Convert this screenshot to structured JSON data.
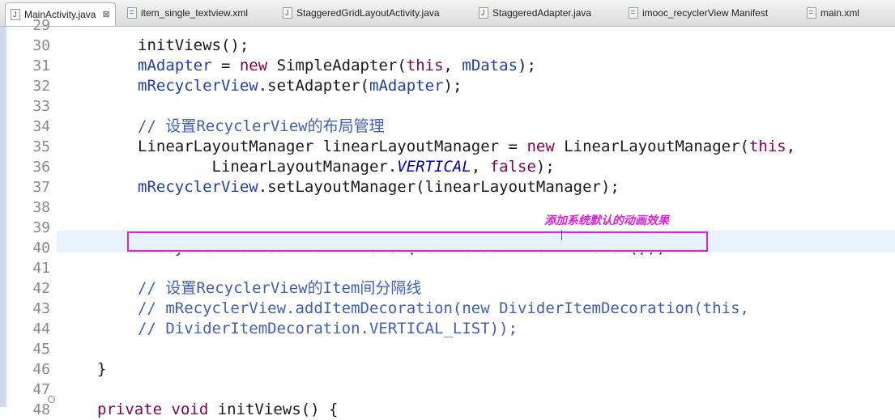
{
  "tabs": [
    {
      "label": "MainActivity.java",
      "icon": "java-file-icon",
      "active": true
    },
    {
      "label": "item_single_textview.xml",
      "icon": "xml-file-icon"
    },
    {
      "label": "StaggeredGridLayoutActivity.java",
      "icon": "java-file-icon"
    },
    {
      "label": "StaggeredAdapter.java",
      "icon": "java-file-icon"
    },
    {
      "label": "imooc_recyclerView Manifest",
      "icon": "xml-file-icon"
    },
    {
      "label": "main.xml",
      "icon": "xml-file-icon"
    }
  ],
  "close_glyph": "⊠",
  "annotation": "添加系统默认的动画效果",
  "lines": [
    {
      "n": "29",
      "tokens": []
    },
    {
      "n": "30",
      "tokens": [
        {
          "t": "initViews();",
          "c": "plain"
        }
      ]
    },
    {
      "n": "31",
      "tokens": [
        {
          "t": "mAdapter",
          "c": "field"
        },
        {
          "t": " = ",
          "c": "plain"
        },
        {
          "t": "new",
          "c": "kw"
        },
        {
          "t": " SimpleAdapter(",
          "c": "plain"
        },
        {
          "t": "this",
          "c": "kw"
        },
        {
          "t": ", ",
          "c": "plain"
        },
        {
          "t": "mDatas",
          "c": "field"
        },
        {
          "t": ");",
          "c": "plain"
        }
      ]
    },
    {
      "n": "32",
      "tokens": [
        {
          "t": "mRecyclerView",
          "c": "field"
        },
        {
          "t": ".setAdapter(",
          "c": "plain"
        },
        {
          "t": "mAdapter",
          "c": "field"
        },
        {
          "t": ");",
          "c": "plain"
        }
      ]
    },
    {
      "n": "33",
      "tokens": []
    },
    {
      "n": "34",
      "tokens": [
        {
          "t": "// 设置RecyclerView的布局管理",
          "c": "cmt"
        }
      ]
    },
    {
      "n": "35",
      "tokens": [
        {
          "t": "LinearLayoutManager linearLayoutManager = ",
          "c": "plain"
        },
        {
          "t": "new",
          "c": "kw"
        },
        {
          "t": " LinearLayoutManager(",
          "c": "plain"
        },
        {
          "t": "this",
          "c": "kw"
        },
        {
          "t": ",",
          "c": "plain"
        }
      ]
    },
    {
      "n": "36",
      "tokens": [
        {
          "t": "        LinearLayoutManager.",
          "c": "plain"
        },
        {
          "t": "VERTICAL",
          "c": "static"
        },
        {
          "t": ", ",
          "c": "plain"
        },
        {
          "t": "false",
          "c": "kw"
        },
        {
          "t": ");",
          "c": "plain"
        }
      ]
    },
    {
      "n": "37",
      "tokens": [
        {
          "t": "mRecyclerView",
          "c": "field"
        },
        {
          "t": ".setLayoutManager(linearLayoutManager);",
          "c": "plain"
        }
      ]
    },
    {
      "n": "38",
      "tokens": []
    },
    {
      "n": "39",
      "tokens": []
    },
    {
      "n": "40",
      "tokens": [
        {
          "t": "mRecyclerView",
          "c": "field"
        },
        {
          "t": ".setItemAnimator(",
          "c": "plain"
        },
        {
          "t": "new",
          "c": "kw"
        },
        {
          "t": " DefaultItemAnimator());",
          "c": "plain"
        }
      ]
    },
    {
      "n": "41",
      "tokens": []
    },
    {
      "n": "42",
      "tokens": [
        {
          "t": "// 设置RecyclerView的Item间分隔线",
          "c": "cmt"
        }
      ]
    },
    {
      "n": "43",
      "tokens": [
        {
          "t": "// mRecyclerView.addItemDecoration(new DividerItemDecoration(this,",
          "c": "cmt"
        }
      ]
    },
    {
      "n": "44",
      "tokens": [
        {
          "t": "// DividerItemDecoration.VERTICAL_LIST));",
          "c": "cmt"
        }
      ]
    },
    {
      "n": "45",
      "tokens": []
    },
    {
      "n": "46",
      "tokens": [
        {
          "t": "}",
          "c": "plain"
        }
      ]
    },
    {
      "n": "47",
      "tokens": []
    },
    {
      "n": "48",
      "tokens": [
        {
          "t": "private",
          "c": "kw"
        },
        {
          "t": " ",
          "c": "plain"
        },
        {
          "t": "void",
          "c": "kw"
        },
        {
          "t": " initViews() {",
          "c": "plain"
        }
      ]
    }
  ]
}
